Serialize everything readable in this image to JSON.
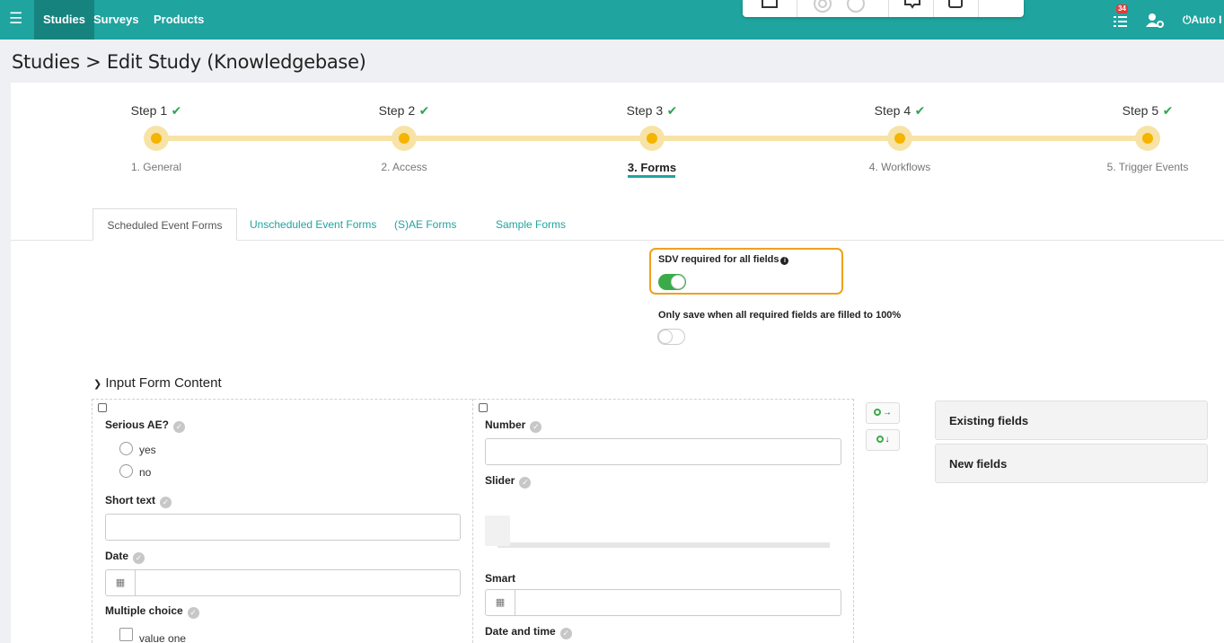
{
  "nav": {
    "items": [
      "Studies",
      "Surveys",
      "Products"
    ],
    "notification_count": "34",
    "user_label": "Auto I"
  },
  "breadcrumb": "Studies > Edit Study (Knowledgebase)",
  "steps": [
    {
      "title": "Step 1",
      "label": "1. General"
    },
    {
      "title": "Step 2",
      "label": "2. Access"
    },
    {
      "title": "Step 3",
      "label": "3. Forms"
    },
    {
      "title": "Step 4",
      "label": "4. Workflows"
    },
    {
      "title": "Step 5",
      "label": "5. Trigger Events"
    }
  ],
  "tabs": [
    "Scheduled Event Forms",
    "Unscheduled Event Forms",
    "(S)AE Forms",
    "Sample Forms"
  ],
  "toggles": {
    "sdv_label": "SDV required for all fields",
    "sdv_on": true,
    "save_label": "Only save when all required fields are filled to 100%",
    "save_on": false
  },
  "section_title": "Input Form Content",
  "fields": {
    "serious_ae": "Serious AE?",
    "options": [
      "yes",
      "no"
    ],
    "short_text": "Short text",
    "date": "Date",
    "multiple_choice": "Multiple choice",
    "mc_options": [
      "value one"
    ],
    "number": "Number",
    "slider": "Slider",
    "smart": "Smart",
    "date_time": "Date and time"
  },
  "panels": [
    "Existing fields",
    "New fields"
  ],
  "colors": {
    "accent": "#1fa4a0",
    "step": "#f4b400",
    "toggle_on": "#3bab4a",
    "highlight": "#f0a01e"
  }
}
